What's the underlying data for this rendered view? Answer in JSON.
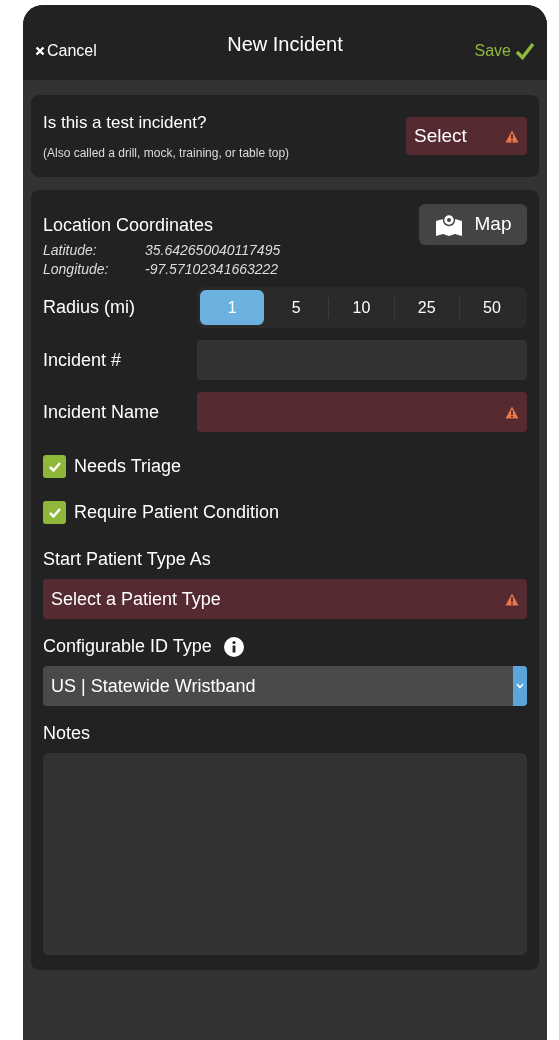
{
  "header": {
    "cancel": "Cancel",
    "title": "New Incident",
    "save": "Save"
  },
  "test_incident": {
    "question": "Is this a test incident?",
    "hint": "(Also called a drill, mock, training, or table top)",
    "select": {
      "value": "Select",
      "error": true
    }
  },
  "location": {
    "title": "Location Coordinates",
    "map_button": "Map",
    "latitude_label": "Latitude:",
    "latitude": "35.642650040117495",
    "longitude_label": "Longitude:",
    "longitude": "-97.57102341663222"
  },
  "radius": {
    "label": "Radius (mi)",
    "options": [
      {
        "label": "1",
        "selected": true
      },
      {
        "label": "5",
        "selected": false
      },
      {
        "label": "10",
        "selected": false
      },
      {
        "label": "25",
        "selected": false
      },
      {
        "label": "50",
        "selected": false
      }
    ]
  },
  "fields": [
    {
      "label": "Incident #",
      "error": false
    },
    {
      "label": "Incident Name",
      "error": true
    }
  ],
  "checkboxes": [
    {
      "label": "Needs Triage",
      "checked": true
    },
    {
      "label": "Require Patient Condition",
      "checked": true
    }
  ],
  "patient_type": {
    "label": "Start Patient Type As",
    "value": "Select a Patient Type",
    "error": true
  },
  "id_type": {
    "label": "Configurable ID Type",
    "value": "US | Statewide Wristband"
  },
  "notes": {
    "label": "Notes"
  }
}
